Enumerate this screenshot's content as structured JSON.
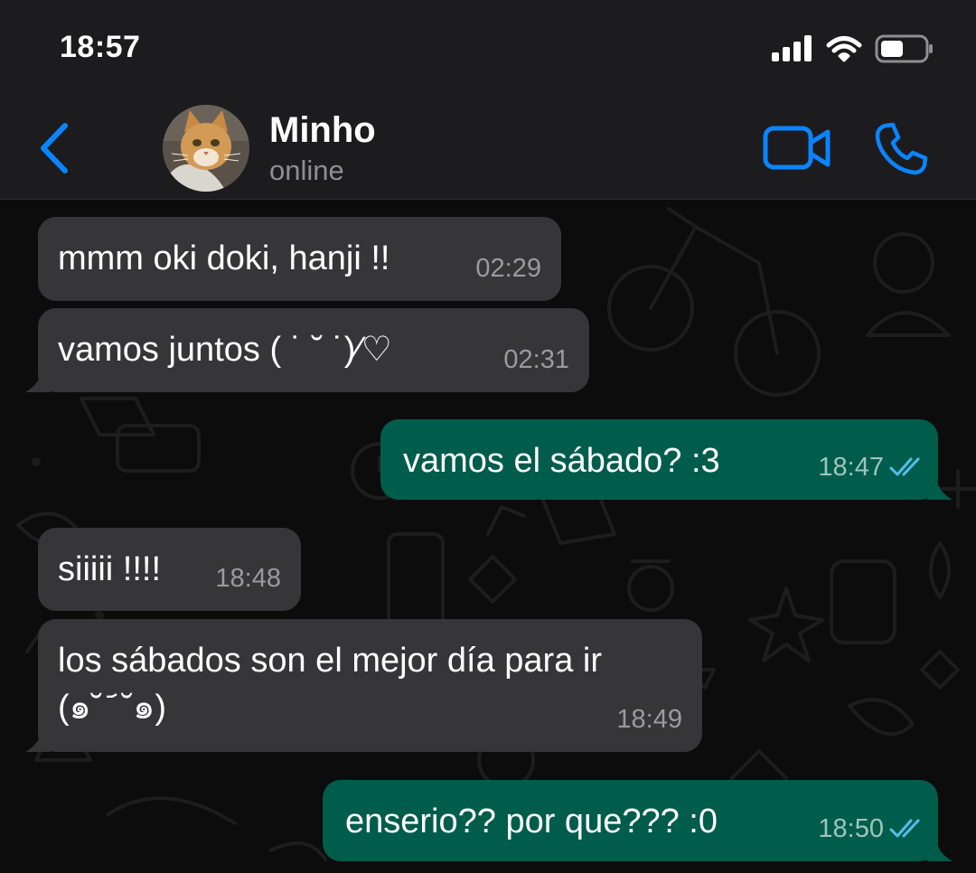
{
  "status_bar": {
    "time": "18:57",
    "icons": [
      "cellular-signal-icon",
      "wifi-icon",
      "battery-icon"
    ]
  },
  "header": {
    "back_icon": "chevron-left-icon",
    "contact_name": "Minho",
    "contact_status": "online",
    "actions": [
      "video-call-icon",
      "phone-call-icon"
    ]
  },
  "messages": [
    {
      "direction": "in",
      "text": "mmm oki doki, hanji !!",
      "time": "02:29"
    },
    {
      "direction": "in",
      "text": "vamos juntos ( ˙ ˘ ˙)⁄♡",
      "time": "02:31"
    },
    {
      "direction": "out",
      "text": "vamos el sábado? :3",
      "time": "18:47",
      "receipt": "read"
    },
    {
      "direction": "in",
      "text": "siiiii !!!!",
      "time": "18:48"
    },
    {
      "direction": "in",
      "text": "los sábados son el mejor día para ir",
      "text2": "(๑˘ ᷄ ˘๑)",
      "time": "18:49"
    },
    {
      "direction": "out",
      "text": "enserio?? por que??? :0",
      "time": "18:50",
      "receipt": "read"
    }
  ],
  "colors": {
    "accent": "#0a84ff",
    "header_bg": "#1c1c1e",
    "incoming_bubble": "#363638",
    "outgoing_bubble": "#005c4b",
    "read_receipt": "#53bdeb",
    "chat_bg": "#0c0c0c"
  }
}
